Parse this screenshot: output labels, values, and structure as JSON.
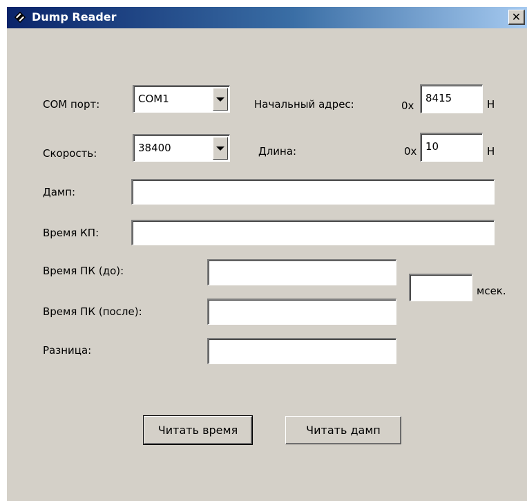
{
  "window": {
    "title": "Dump Reader",
    "close_glyph": "✕"
  },
  "com_port": {
    "label": "COM порт:",
    "value": "COM1"
  },
  "speed": {
    "label": "Скорость:",
    "value": "38400"
  },
  "start_address": {
    "label": "Начальный адрес:",
    "prefix": "0x",
    "value": "8415",
    "suffix": "H"
  },
  "length": {
    "label": "Длина:",
    "prefix": "0x",
    "value": "10",
    "suffix": "H"
  },
  "dump": {
    "label": "Дамп:",
    "value": ""
  },
  "kp_time": {
    "label": "Время КП:",
    "value": ""
  },
  "pc_time_before": {
    "label": "Время ПК (до):",
    "value": ""
  },
  "pc_time_after": {
    "label": "Время ПК (после):",
    "value": ""
  },
  "difference": {
    "label": "Разница:",
    "value": ""
  },
  "msec": {
    "value": "",
    "unit": "мсек."
  },
  "buttons": {
    "read_time": "Читать время",
    "read_dump": "Читать дамп"
  },
  "icons": {
    "app": "diamond-app-icon",
    "close": "close-icon",
    "combo": "chevron-down-icon"
  }
}
